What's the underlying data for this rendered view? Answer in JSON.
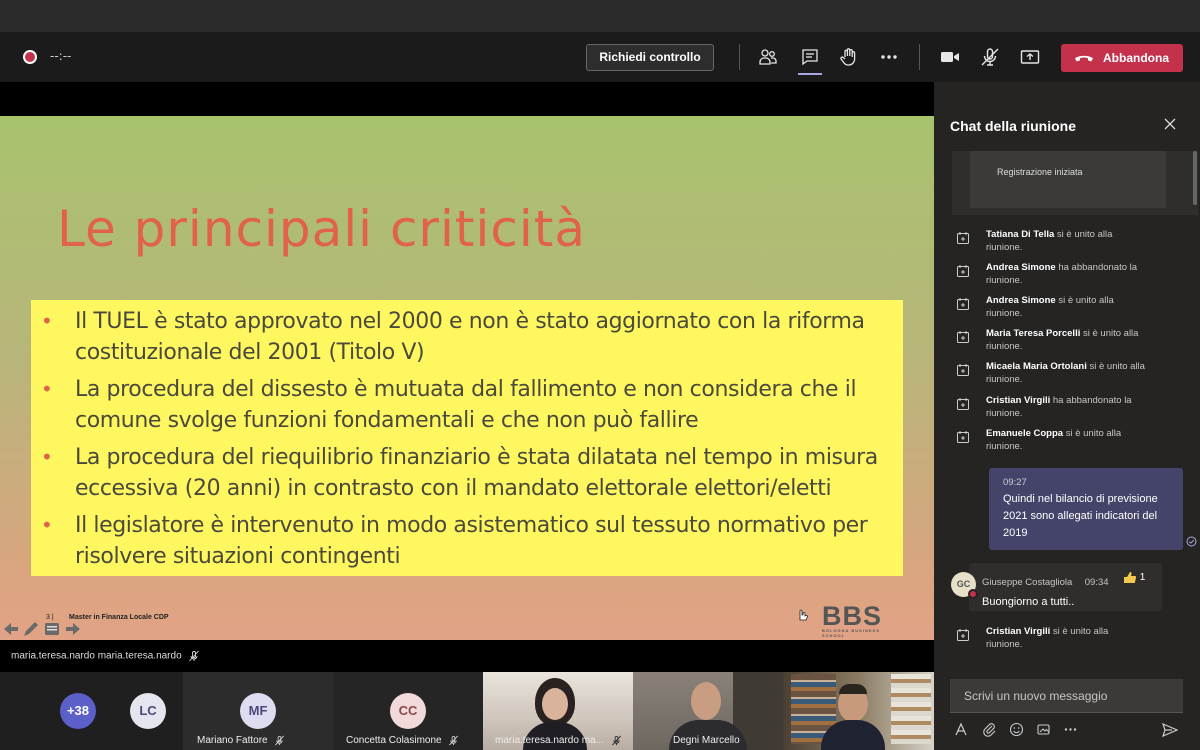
{
  "toolbar": {
    "record_time": "--:--",
    "request_control_label": "Richiedi controllo",
    "leave_label": "Abbandona",
    "icons": [
      "participants-icon",
      "chat-icon",
      "raise-hand-icon",
      "more-icon",
      "camera-icon",
      "mic-off-icon",
      "share-screen-icon"
    ]
  },
  "slide": {
    "title": "Le principali criticità",
    "bullets": [
      "Il TUEL è stato approvato nel 2000 e non è stato aggiornato con la riforma costituzionale del 2001 (Titolo V)",
      "La procedura del dissesto è mutuata dal fallimento e non considera che il comune svolge funzioni fondamentali e che non può fallire",
      "La procedura del riequilibrio finanziario è stata dilatata nel tempo in misura eccessiva (20 anni) in contrasto con il mandato elettorale elettori/eletti",
      "Il legislatore è intervenuto in modo asistematico sul tessuto normativo per risolvere situazioni contingenti"
    ],
    "bullet_glyph": "•",
    "page_number": "3 |",
    "footer": "Master in Finanza Locale CDP",
    "logo_letters": "BBS",
    "logo_subtitle": "BOLOGNA BUSINESS SCHOOL",
    "colors": {
      "title": "#e0624a",
      "box": "#fef760"
    }
  },
  "presenter": {
    "name": "maria.teresa.nardo maria.teresa.nardo"
  },
  "participants": {
    "overflow_count": "+38",
    "lc_initials": "LC",
    "tiles": [
      {
        "initials": "MF",
        "name": "Mariano Fattore"
      },
      {
        "initials": "CC",
        "name": "Concetta Colasimone"
      },
      {
        "initials": "",
        "name": "maria.teresa.nardo ma..."
      },
      {
        "initials": "",
        "name": "Degni Marcello"
      },
      {
        "initials": "",
        "name": ""
      }
    ]
  },
  "chat": {
    "title": "Chat della riunione",
    "recording_notice": "Registrazione iniziata",
    "system_messages": [
      {
        "name": "Tatiana Di Tella",
        "text": " si è unito alla riunione."
      },
      {
        "name": "Andrea Simone",
        "text": " ha abbandonato la riunione."
      },
      {
        "name": "Andrea Simone",
        "text": " si è unito alla riunione."
      },
      {
        "name": "Maria Teresa Porcelli",
        "text": " si è unito alla riunione."
      },
      {
        "name": "Micaela Maria Ortolani",
        "text": " si è unito alla riunione."
      },
      {
        "name": "Cristian Virgili",
        "text": " ha abbandonato la riunione."
      },
      {
        "name": "Emanuele Coppa",
        "text": " si è unito alla riunione."
      }
    ],
    "my_message": {
      "time": "09:27",
      "text": "Quindi nel bilancio di previsione 2021 sono allegati indicatori del 2019"
    },
    "other_message": {
      "initials": "GC",
      "author": "Giuseppe Costagliola",
      "time": "09:34",
      "text": "Buongiorno a tutti..",
      "likes": "1"
    },
    "last_system_message": {
      "name": "Cristian Virgili",
      "text": " si è unito alla riunione."
    },
    "compose_placeholder": "Scrivi un nuovo messaggio",
    "compose_tools": [
      "format-icon",
      "attach-icon",
      "emoji-icon",
      "sticker-icon",
      "more-icon"
    ]
  }
}
